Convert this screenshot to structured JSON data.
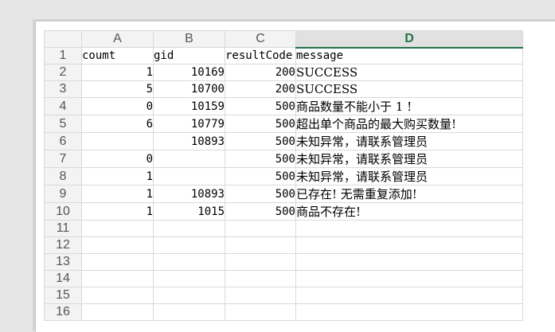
{
  "columns": [
    "A",
    "B",
    "C",
    "D"
  ],
  "active_column": "D",
  "rows": [
    {
      "num": "1",
      "a": "coumt",
      "b": "gid",
      "c": "resultCode",
      "d": "message"
    },
    {
      "num": "2",
      "a": "1",
      "b": "10169",
      "c": "200",
      "d": "SUCCESS"
    },
    {
      "num": "3",
      "a": "5",
      "b": "10700",
      "c": "200",
      "d": "SUCCESS"
    },
    {
      "num": "4",
      "a": "0",
      "b": "10159",
      "c": "500",
      "d": "商品数量不能小于 1 !"
    },
    {
      "num": "5",
      "a": "6",
      "b": "10779",
      "c": "500",
      "d": "超出单个商品的最大购买数量!"
    },
    {
      "num": "6",
      "a": "",
      "b": "10893",
      "c": "500",
      "d": "未知异常，请联系管理员"
    },
    {
      "num": "7",
      "a": "0",
      "b": "",
      "c": "500",
      "d": "未知异常，请联系管理员"
    },
    {
      "num": "8",
      "a": "1",
      "b": "",
      "c": "500",
      "d": "未知异常，请联系管理员"
    },
    {
      "num": "9",
      "a": "1",
      "b": "10893",
      "c": "500",
      "d": "已存在! 无需重复添加!"
    },
    {
      "num": "10",
      "a": "1",
      "b": "1015",
      "c": "500",
      "d": "商品不存在!"
    },
    {
      "num": "11",
      "a": "",
      "b": "",
      "c": "",
      "d": ""
    },
    {
      "num": "12",
      "a": "",
      "b": "",
      "c": "",
      "d": ""
    },
    {
      "num": "13",
      "a": "",
      "b": "",
      "c": "",
      "d": ""
    },
    {
      "num": "14",
      "a": "",
      "b": "",
      "c": "",
      "d": ""
    },
    {
      "num": "15",
      "a": "",
      "b": "",
      "c": "",
      "d": ""
    },
    {
      "num": "16",
      "a": "",
      "b": "",
      "c": "",
      "d": ""
    }
  ]
}
